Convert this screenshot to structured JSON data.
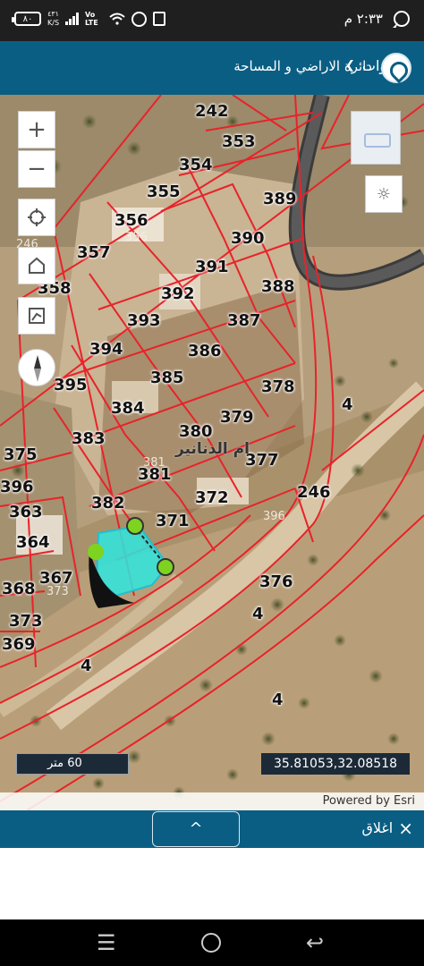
{
  "status_bar": {
    "time": "٢:٣٣ م",
    "battery": "٨٠",
    "speed_value": "٤٣١",
    "speed_unit": "K/S",
    "network": "Vo LTE"
  },
  "header": {
    "title": "دائرة الاراضي و المساحة",
    "tools_label": "اداوات"
  },
  "map": {
    "zoom_in": "+",
    "zoom_out": "−",
    "scale_label": "60 متر",
    "coordinates": "35.81053,32.08518",
    "attribution": "Powered by Esri",
    "locality_label": "ام الدنانير",
    "parcel_labels": [
      "242",
      "353",
      "354",
      "355",
      "356",
      "389",
      "390",
      "391",
      "357",
      "358",
      "392",
      "388",
      "393",
      "387",
      "394",
      "386",
      "395",
      "385",
      "378",
      "384",
      "379",
      "380",
      "383",
      "381",
      "377",
      "382",
      "376",
      "375",
      "396",
      "363",
      "364",
      "367",
      "368",
      "373",
      "369",
      "372",
      "371",
      "246",
      "4",
      "4",
      "4",
      "4",
      "4"
    ],
    "small_parcel_labels": [
      "356",
      "381",
      "373",
      "396",
      "246"
    ],
    "colors": {
      "parcel_boundary": "#e8232a",
      "selected_parcel": "#2ee6e0",
      "vertex_marker": "#7ed321",
      "header": "#0a5e83",
      "info_box": "#1c2a38"
    }
  },
  "bottom_bar": {
    "collapse_icon": "^",
    "close_label": "اغلاق",
    "close_icon": "×"
  },
  "nav": {
    "menu_icon": "☰",
    "back_icon": "↩"
  }
}
